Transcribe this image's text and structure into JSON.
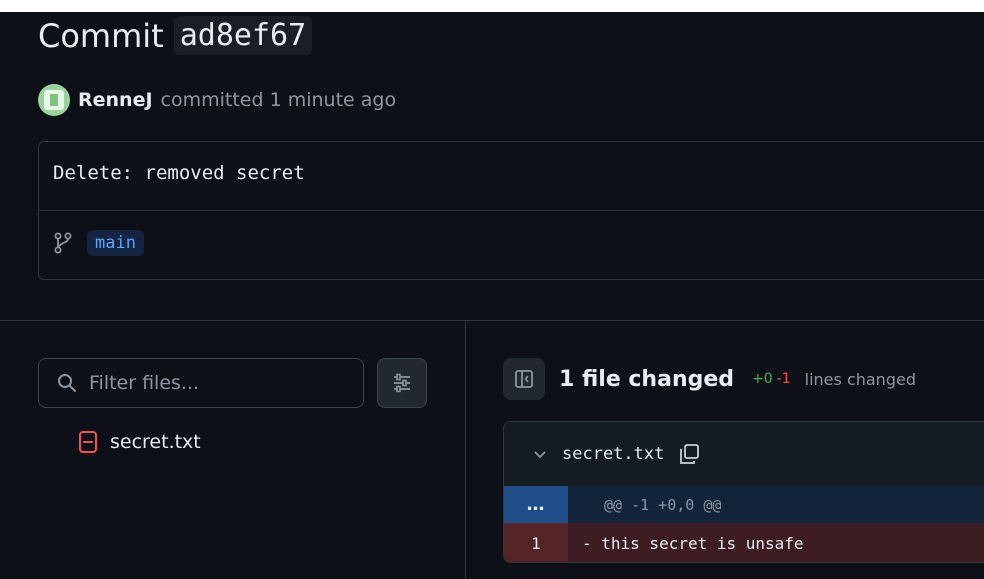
{
  "commit": {
    "title_prefix": "Commit",
    "sha": "ad8ef67",
    "author": "RenneJ",
    "committed_text": "committed 1 minute ago",
    "message": "Delete: removed secret",
    "branch": "main"
  },
  "file_tree": {
    "filter_placeholder": "Filter files...",
    "files": [
      {
        "name": "secret.txt",
        "status": "deleted"
      }
    ]
  },
  "diff": {
    "summary": "1 file changed",
    "additions": "+0",
    "deletions": "-1",
    "lines_changed_label": "lines changed",
    "file": {
      "name": "secret.txt",
      "hunk_marker": "…",
      "hunk_header": "@@ -1 +0,0 @@",
      "lines": [
        {
          "number": "1",
          "text": "- this secret is unsafe",
          "type": "deletion"
        }
      ]
    }
  },
  "colors": {
    "background": "#0d1117",
    "accent_blue": "#58a6ff",
    "addition_green": "#3fb950",
    "deletion_red": "#f85149"
  },
  "icons": [
    "avatar",
    "git-branch-icon",
    "search-icon",
    "settings-sliders-icon",
    "file-deleted-icon",
    "sidebar-toggle-icon",
    "chevron-down-icon",
    "copy-icon"
  ]
}
